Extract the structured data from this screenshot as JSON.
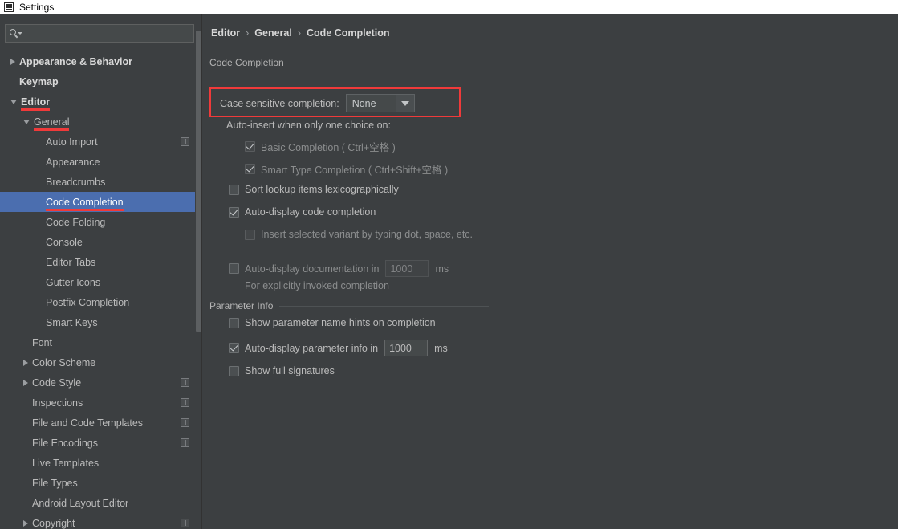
{
  "window": {
    "title": "Settings",
    "app_icon": "intellij-icon"
  },
  "colors": {
    "background": "#3c3f41",
    "selection": "#4b6eaf",
    "highlight_red": "#f03a3a",
    "text": "#bbbbbb",
    "titlebar": "#ffffff"
  },
  "sidebar": {
    "search": {
      "value": "",
      "placeholder": "",
      "icon": "search-icon"
    },
    "items": [
      {
        "label": "Appearance & Behavior",
        "indent": 0,
        "arrow": "collapsed",
        "bold": true,
        "selected": false,
        "underline": false,
        "scope_icon": false
      },
      {
        "label": "Keymap",
        "indent": 0,
        "arrow": "none",
        "bold": true,
        "selected": false,
        "underline": false,
        "scope_icon": false
      },
      {
        "label": "Editor",
        "indent": 0,
        "arrow": "expanded",
        "bold": true,
        "selected": false,
        "underline": true,
        "scope_icon": false
      },
      {
        "label": "General",
        "indent": 1,
        "arrow": "expanded",
        "bold": false,
        "selected": false,
        "underline": true,
        "scope_icon": false
      },
      {
        "label": "Auto Import",
        "indent": 2,
        "arrow": "none",
        "bold": false,
        "selected": false,
        "underline": false,
        "scope_icon": true
      },
      {
        "label": "Appearance",
        "indent": 2,
        "arrow": "none",
        "bold": false,
        "selected": false,
        "underline": false,
        "scope_icon": false
      },
      {
        "label": "Breadcrumbs",
        "indent": 2,
        "arrow": "none",
        "bold": false,
        "selected": false,
        "underline": false,
        "scope_icon": false
      },
      {
        "label": "Code Completion",
        "indent": 2,
        "arrow": "none",
        "bold": false,
        "selected": true,
        "underline": true,
        "scope_icon": false
      },
      {
        "label": "Code Folding",
        "indent": 2,
        "arrow": "none",
        "bold": false,
        "selected": false,
        "underline": false,
        "scope_icon": false
      },
      {
        "label": "Console",
        "indent": 2,
        "arrow": "none",
        "bold": false,
        "selected": false,
        "underline": false,
        "scope_icon": false
      },
      {
        "label": "Editor Tabs",
        "indent": 2,
        "arrow": "none",
        "bold": false,
        "selected": false,
        "underline": false,
        "scope_icon": false
      },
      {
        "label": "Gutter Icons",
        "indent": 2,
        "arrow": "none",
        "bold": false,
        "selected": false,
        "underline": false,
        "scope_icon": false
      },
      {
        "label": "Postfix Completion",
        "indent": 2,
        "arrow": "none",
        "bold": false,
        "selected": false,
        "underline": false,
        "scope_icon": false
      },
      {
        "label": "Smart Keys",
        "indent": 2,
        "arrow": "none",
        "bold": false,
        "selected": false,
        "underline": false,
        "scope_icon": false
      },
      {
        "label": "Font",
        "indent": 1,
        "arrow": "none",
        "bold": false,
        "selected": false,
        "underline": false,
        "scope_icon": false
      },
      {
        "label": "Color Scheme",
        "indent": 1,
        "arrow": "collapsed",
        "bold": false,
        "selected": false,
        "underline": false,
        "scope_icon": false
      },
      {
        "label": "Code Style",
        "indent": 1,
        "arrow": "collapsed",
        "bold": false,
        "selected": false,
        "underline": false,
        "scope_icon": true
      },
      {
        "label": "Inspections",
        "indent": 1,
        "arrow": "none",
        "bold": false,
        "selected": false,
        "underline": false,
        "scope_icon": true
      },
      {
        "label": "File and Code Templates",
        "indent": 1,
        "arrow": "none",
        "bold": false,
        "selected": false,
        "underline": false,
        "scope_icon": true
      },
      {
        "label": "File Encodings",
        "indent": 1,
        "arrow": "none",
        "bold": false,
        "selected": false,
        "underline": false,
        "scope_icon": true
      },
      {
        "label": "Live Templates",
        "indent": 1,
        "arrow": "none",
        "bold": false,
        "selected": false,
        "underline": false,
        "scope_icon": false
      },
      {
        "label": "File Types",
        "indent": 1,
        "arrow": "none",
        "bold": false,
        "selected": false,
        "underline": false,
        "scope_icon": false
      },
      {
        "label": "Android Layout Editor",
        "indent": 1,
        "arrow": "none",
        "bold": false,
        "selected": false,
        "underline": false,
        "scope_icon": false
      },
      {
        "label": "Copyright",
        "indent": 1,
        "arrow": "collapsed",
        "bold": false,
        "selected": false,
        "underline": false,
        "scope_icon": true
      }
    ]
  },
  "main": {
    "breadcrumb": [
      "Editor",
      "General",
      "Code Completion"
    ],
    "breadcrumb_separator": "›",
    "sections": {
      "code_completion": {
        "title": "Code Completion",
        "case_sensitive": {
          "label": "Case sensitive completion:",
          "value": "None",
          "arrow_icon": "chevron-down-icon",
          "highlighted": true
        },
        "auto_insert_label": "Auto-insert when only one choice on:",
        "basic_completion": {
          "label": "Basic Completion ( Ctrl+空格 )",
          "checked": true,
          "enabled": false
        },
        "smart_type_completion": {
          "label": "Smart Type Completion ( Ctrl+Shift+空格 )",
          "checked": true,
          "enabled": false
        },
        "sort_lookup": {
          "label": "Sort lookup items lexicographically",
          "checked": false,
          "enabled": true
        },
        "auto_display_completion": {
          "label": "Auto-display code completion",
          "checked": true,
          "enabled": true
        },
        "insert_selected_variant": {
          "label": "Insert selected variant by typing dot, space, etc.",
          "checked": false,
          "enabled": false
        },
        "auto_display_doc": {
          "label": "Auto-display documentation in",
          "checked": false,
          "enabled": true,
          "delay": "1000",
          "unit": "ms"
        },
        "auto_display_doc_hint": "For explicitly invoked completion"
      },
      "parameter_info": {
        "title": "Parameter Info",
        "show_param_hints": {
          "label": "Show parameter name hints on completion",
          "checked": false,
          "enabled": true
        },
        "auto_display_param": {
          "label": "Auto-display parameter info in",
          "checked": true,
          "enabled": true,
          "delay": "1000",
          "unit": "ms"
        },
        "show_full_signatures": {
          "label": "Show full signatures",
          "checked": false,
          "enabled": true
        }
      }
    }
  }
}
